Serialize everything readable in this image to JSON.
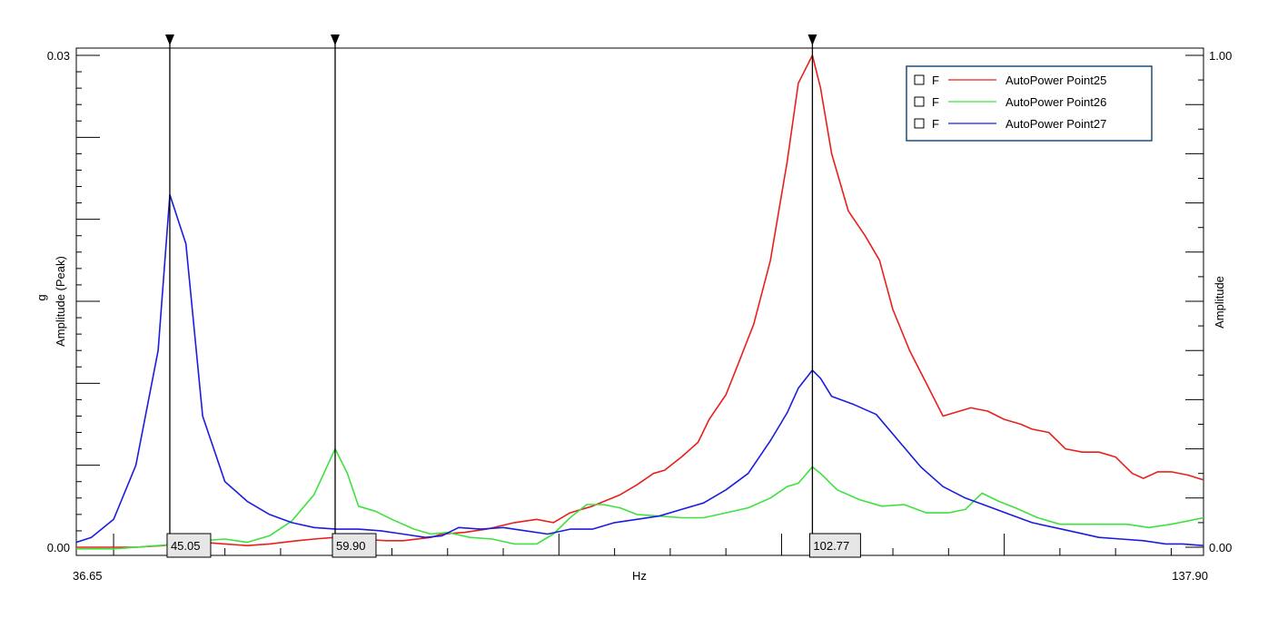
{
  "chart_data": {
    "type": "line",
    "xlabel": "Hz",
    "ylabel_left": "Amplitude (Peak)",
    "ylabel_left_unit": "g",
    "ylabel_right": "Amplitude",
    "xlim": [
      36.65,
      137.9
    ],
    "x_tick_labels": [
      "36.65",
      "137.90"
    ],
    "ylim_left": [
      0.0,
      0.03
    ],
    "y_left_tick_labels": [
      "0.03",
      "0.00"
    ],
    "ylim_right": [
      0.0,
      1.0
    ],
    "y_right_tick_labels": [
      "1.00",
      "0.00"
    ],
    "grid": false,
    "legend_position": "top-right",
    "legend_checkbox_label": "F",
    "cursors": [
      {
        "value": 45.05,
        "label": "45.05"
      },
      {
        "value": 59.9,
        "label": "59.90"
      },
      {
        "value": 102.77,
        "label": "102.77"
      }
    ],
    "series": [
      {
        "name": "AutoPower Point25",
        "color": "#e8201c",
        "points": [
          [
            36.65,
            0.0
          ],
          [
            39.0,
            0.0
          ],
          [
            42.0,
            0.0
          ],
          [
            44.5,
            0.0001
          ],
          [
            46.0,
            0.0003
          ],
          [
            48.0,
            0.0003
          ],
          [
            50.0,
            0.0002
          ],
          [
            52.0,
            0.0001
          ],
          [
            54.0,
            0.0002
          ],
          [
            56.5,
            0.0004
          ],
          [
            58.0,
            0.0005
          ],
          [
            59.9,
            0.0006
          ],
          [
            62.0,
            0.0005
          ],
          [
            64.5,
            0.0004
          ],
          [
            66.0,
            0.0004
          ],
          [
            68.5,
            0.0006
          ],
          [
            69.5,
            0.0008
          ],
          [
            71.5,
            0.0009
          ],
          [
            73.5,
            0.0011
          ],
          [
            76.0,
            0.0015
          ],
          [
            78.0,
            0.0017
          ],
          [
            79.5,
            0.0015
          ],
          [
            81.0,
            0.0021
          ],
          [
            83.0,
            0.0025
          ],
          [
            85.5,
            0.0032
          ],
          [
            87.0,
            0.0038
          ],
          [
            88.5,
            0.0045
          ],
          [
            89.5,
            0.0047
          ],
          [
            91.0,
            0.0055
          ],
          [
            92.5,
            0.0064
          ],
          [
            93.5,
            0.0078
          ],
          [
            95.0,
            0.0093
          ],
          [
            96.0,
            0.011
          ],
          [
            97.5,
            0.0136
          ],
          [
            99.0,
            0.0175
          ],
          [
            100.5,
            0.0235
          ],
          [
            101.5,
            0.0283
          ],
          [
            102.77,
            0.03
          ],
          [
            103.5,
            0.028
          ],
          [
            104.5,
            0.024
          ],
          [
            106.0,
            0.0205
          ],
          [
            107.5,
            0.019
          ],
          [
            108.8,
            0.0175
          ],
          [
            110.0,
            0.0145
          ],
          [
            111.5,
            0.012
          ],
          [
            113.0,
            0.01
          ],
          [
            114.5,
            0.008
          ],
          [
            116.0,
            0.0083
          ],
          [
            117.0,
            0.0085
          ],
          [
            118.5,
            0.0083
          ],
          [
            120.0,
            0.0078
          ],
          [
            121.5,
            0.0075
          ],
          [
            122.5,
            0.0072
          ],
          [
            124.0,
            0.007
          ],
          [
            125.5,
            0.006
          ],
          [
            127.0,
            0.0058
          ],
          [
            128.5,
            0.0058
          ],
          [
            130.0,
            0.0055
          ],
          [
            131.5,
            0.0045
          ],
          [
            132.5,
            0.0042
          ],
          [
            133.8,
            0.0046
          ],
          [
            135.0,
            0.0046
          ],
          [
            136.5,
            0.0044
          ],
          [
            137.9,
            0.0041
          ]
        ]
      },
      {
        "name": "AutoPower Point26",
        "color": "#3fe03f",
        "points": [
          [
            36.65,
            -0.0001
          ],
          [
            40.0,
            -0.0001
          ],
          [
            44.0,
            0.0001
          ],
          [
            46.0,
            0.0002
          ],
          [
            48.0,
            0.0004
          ],
          [
            50.0,
            0.0005
          ],
          [
            52.0,
            0.0003
          ],
          [
            54.0,
            0.0007
          ],
          [
            56.0,
            0.0016
          ],
          [
            58.0,
            0.0032
          ],
          [
            59.9,
            0.006
          ],
          [
            61.0,
            0.0045
          ],
          [
            62.0,
            0.0025
          ],
          [
            63.5,
            0.0022
          ],
          [
            65.0,
            0.0017
          ],
          [
            67.0,
            0.0011
          ],
          [
            68.5,
            0.0008
          ],
          [
            70.0,
            0.0009
          ],
          [
            72.0,
            0.0006
          ],
          [
            74.0,
            0.0005
          ],
          [
            76.0,
            0.0002
          ],
          [
            78.0,
            0.0002
          ],
          [
            79.5,
            0.0008
          ],
          [
            81.0,
            0.0018
          ],
          [
            82.5,
            0.0026
          ],
          [
            84.0,
            0.0026
          ],
          [
            85.5,
            0.0024
          ],
          [
            87.0,
            0.002
          ],
          [
            89.0,
            0.0019
          ],
          [
            91.0,
            0.0018
          ],
          [
            93.0,
            0.0018
          ],
          [
            95.0,
            0.0021
          ],
          [
            97.0,
            0.0024
          ],
          [
            99.0,
            0.003
          ],
          [
            100.5,
            0.0037
          ],
          [
            101.5,
            0.0039
          ],
          [
            102.77,
            0.0049
          ],
          [
            103.5,
            0.0045
          ],
          [
            105.0,
            0.0035
          ],
          [
            107.0,
            0.0029
          ],
          [
            109.0,
            0.0025
          ],
          [
            111.0,
            0.0026
          ],
          [
            113.0,
            0.0021
          ],
          [
            115.0,
            0.0021
          ],
          [
            116.5,
            0.0023
          ],
          [
            118.0,
            0.0033
          ],
          [
            119.5,
            0.0028
          ],
          [
            121.0,
            0.0024
          ],
          [
            123.0,
            0.0018
          ],
          [
            125.0,
            0.0014
          ],
          [
            127.0,
            0.0014
          ],
          [
            129.0,
            0.0014
          ],
          [
            131.0,
            0.0014
          ],
          [
            133.0,
            0.0012
          ],
          [
            135.0,
            0.0014
          ],
          [
            137.9,
            0.0018
          ]
        ]
      },
      {
        "name": "AutoPower Point27",
        "color": "#1c1ce0",
        "points": [
          [
            36.65,
            0.0003
          ],
          [
            38.0,
            0.0006
          ],
          [
            40.0,
            0.0017
          ],
          [
            42.0,
            0.005
          ],
          [
            44.0,
            0.012
          ],
          [
            45.05,
            0.0215
          ],
          [
            46.5,
            0.0185
          ],
          [
            48.0,
            0.008
          ],
          [
            50.0,
            0.004
          ],
          [
            52.0,
            0.0028
          ],
          [
            54.0,
            0.002
          ],
          [
            56.0,
            0.0015
          ],
          [
            58.0,
            0.0012
          ],
          [
            60.0,
            0.0011
          ],
          [
            62.0,
            0.0011
          ],
          [
            64.0,
            0.001
          ],
          [
            66.0,
            0.0008
          ],
          [
            68.0,
            0.0006
          ],
          [
            69.5,
            0.0007
          ],
          [
            71.0,
            0.0012
          ],
          [
            73.0,
            0.0011
          ],
          [
            75.0,
            0.0012
          ],
          [
            77.0,
            0.001
          ],
          [
            79.0,
            0.0008
          ],
          [
            81.0,
            0.0011
          ],
          [
            83.0,
            0.0011
          ],
          [
            85.0,
            0.0015
          ],
          [
            87.0,
            0.0017
          ],
          [
            89.0,
            0.0019
          ],
          [
            91.0,
            0.0023
          ],
          [
            93.0,
            0.0027
          ],
          [
            95.0,
            0.0035
          ],
          [
            97.0,
            0.0045
          ],
          [
            99.0,
            0.0065
          ],
          [
            100.5,
            0.0082
          ],
          [
            101.5,
            0.0097
          ],
          [
            102.77,
            0.0108
          ],
          [
            103.5,
            0.0103
          ],
          [
            104.5,
            0.0092
          ],
          [
            106.5,
            0.0087
          ],
          [
            108.5,
            0.0081
          ],
          [
            110.5,
            0.0065
          ],
          [
            112.5,
            0.0049
          ],
          [
            114.5,
            0.0037
          ],
          [
            116.5,
            0.003
          ],
          [
            118.5,
            0.0025
          ],
          [
            120.5,
            0.002
          ],
          [
            122.5,
            0.0015
          ],
          [
            124.5,
            0.0012
          ],
          [
            126.5,
            0.0009
          ],
          [
            128.5,
            0.0006
          ],
          [
            130.5,
            0.0005
          ],
          [
            132.5,
            0.0004
          ],
          [
            134.5,
            0.0002
          ],
          [
            136.0,
            0.0002
          ],
          [
            137.9,
            0.0001
          ]
        ]
      }
    ]
  }
}
